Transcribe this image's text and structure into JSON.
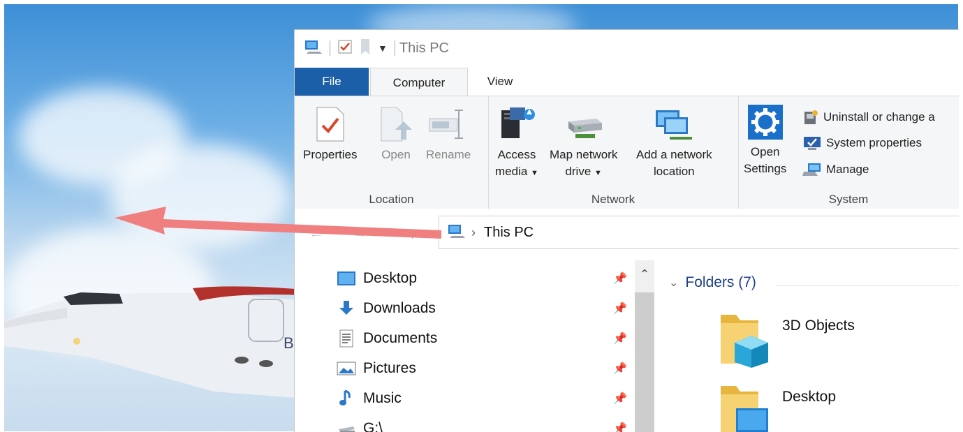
{
  "window": {
    "title": "This PC"
  },
  "tabs": [
    {
      "label": "File"
    },
    {
      "label": "Computer"
    },
    {
      "label": "View"
    }
  ],
  "ribbon": {
    "location": {
      "label": "Location",
      "properties": "Properties",
      "open": "Open",
      "rename": "Rename"
    },
    "network": {
      "label": "Network",
      "access_media_1": "Access",
      "access_media_2": "media",
      "map_drive_1": "Map network",
      "map_drive_2": "drive",
      "add_location_1": "Add a network",
      "add_location_2": "location"
    },
    "system": {
      "label": "System",
      "open_settings_1": "Open",
      "open_settings_2": "Settings",
      "uninstall": "Uninstall or change a",
      "system_properties": "System properties",
      "manage": "Manage"
    }
  },
  "address": {
    "crumb": "This PC"
  },
  "nav": {
    "items": [
      {
        "label": "Desktop",
        "icon": "desktop-icon"
      },
      {
        "label": "Downloads",
        "icon": "downloads-icon"
      },
      {
        "label": "Documents",
        "icon": "documents-icon"
      },
      {
        "label": "Pictures",
        "icon": "pictures-icon"
      },
      {
        "label": "Music",
        "icon": "music-icon"
      },
      {
        "label": "G:\\",
        "icon": "drive-icon"
      }
    ]
  },
  "content": {
    "section_title": "Folders (7)",
    "folders": [
      {
        "label": "3D Objects"
      },
      {
        "label": "Desktop"
      }
    ]
  },
  "colors": {
    "accent": "#1a5fa8",
    "arrow": "#f08080",
    "section_title": "#1e3f8a"
  }
}
